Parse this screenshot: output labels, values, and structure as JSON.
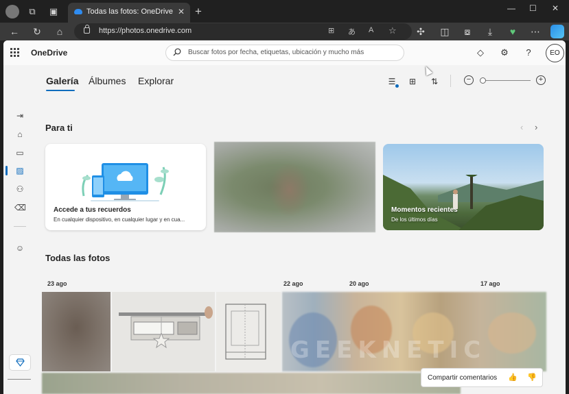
{
  "browser": {
    "tab_title": "Todas las fotos: OneDrive",
    "url": "https://photos.onedrive.com",
    "new_tab": "+",
    "close": "✕"
  },
  "app": {
    "brand": "OneDrive",
    "search_placeholder": "Buscar fotos por fecha, etiquetas, ubicación y mucho más",
    "avatar_initials": "EO"
  },
  "tabs": [
    {
      "label": "Galería",
      "active": true
    },
    {
      "label": "Álbumes",
      "active": false
    },
    {
      "label": "Explorar",
      "active": false
    }
  ],
  "sections": {
    "para_ti": "Para ti",
    "todas": "Todas las fotos"
  },
  "cards": [
    {
      "title": "Accede a tus recuerdos",
      "subtitle": "En cualquier dispositivo, en cualquier lugar y en cua..."
    },
    {
      "title": "",
      "subtitle": ""
    },
    {
      "title": "Momentos recientes",
      "subtitle": "De los últimos días"
    }
  ],
  "dates": [
    "23 ago",
    "22 ago",
    "20 ago",
    "17 ago"
  ],
  "feedback": {
    "label": "Compartir comentarios"
  },
  "watermark": "GEEKNETIC",
  "colors": {
    "accent": "#0f6cbd",
    "chrome": "#202020",
    "app_bg": "#f3f3f3"
  }
}
